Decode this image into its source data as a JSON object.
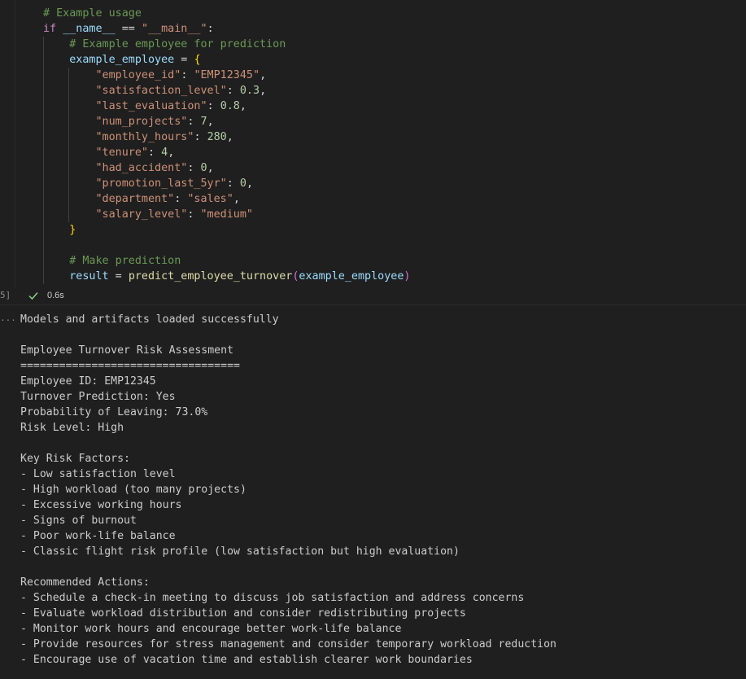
{
  "cell": {
    "execution_count": "5]",
    "exec_time": "0.6s",
    "code_lines": [
      [
        {
          "t": "# Example usage",
          "c": "tok-comment"
        }
      ],
      [
        {
          "t": "if ",
          "c": "tok-kw"
        },
        {
          "t": "__name__",
          "c": "tok-var"
        },
        {
          "t": " == ",
          "c": "tok-op"
        },
        {
          "t": "\"__main__\"",
          "c": "tok-str"
        },
        {
          "t": ":",
          "c": "tok-op"
        }
      ],
      [
        {
          "t": "    # Example employee for prediction",
          "c": "tok-comment"
        }
      ],
      [
        {
          "t": "    ",
          "c": "tok-op"
        },
        {
          "t": "example_employee",
          "c": "tok-var"
        },
        {
          "t": " = ",
          "c": "tok-op"
        },
        {
          "t": "{",
          "c": "tok-brace"
        }
      ],
      [
        {
          "t": "        ",
          "c": "tok-op"
        },
        {
          "t": "\"employee_id\"",
          "c": "tok-str"
        },
        {
          "t": ": ",
          "c": "tok-op"
        },
        {
          "t": "\"EMP12345\"",
          "c": "tok-str"
        },
        {
          "t": ",",
          "c": "tok-op"
        }
      ],
      [
        {
          "t": "        ",
          "c": "tok-op"
        },
        {
          "t": "\"satisfaction_level\"",
          "c": "tok-str"
        },
        {
          "t": ": ",
          "c": "tok-op"
        },
        {
          "t": "0.3",
          "c": "tok-num"
        },
        {
          "t": ",",
          "c": "tok-op"
        }
      ],
      [
        {
          "t": "        ",
          "c": "tok-op"
        },
        {
          "t": "\"last_evaluation\"",
          "c": "tok-str"
        },
        {
          "t": ": ",
          "c": "tok-op"
        },
        {
          "t": "0.8",
          "c": "tok-num"
        },
        {
          "t": ",",
          "c": "tok-op"
        }
      ],
      [
        {
          "t": "        ",
          "c": "tok-op"
        },
        {
          "t": "\"num_projects\"",
          "c": "tok-str"
        },
        {
          "t": ": ",
          "c": "tok-op"
        },
        {
          "t": "7",
          "c": "tok-num"
        },
        {
          "t": ",",
          "c": "tok-op"
        }
      ],
      [
        {
          "t": "        ",
          "c": "tok-op"
        },
        {
          "t": "\"monthly_hours\"",
          "c": "tok-str"
        },
        {
          "t": ": ",
          "c": "tok-op"
        },
        {
          "t": "280",
          "c": "tok-num"
        },
        {
          "t": ",",
          "c": "tok-op"
        }
      ],
      [
        {
          "t": "        ",
          "c": "tok-op"
        },
        {
          "t": "\"tenure\"",
          "c": "tok-str"
        },
        {
          "t": ": ",
          "c": "tok-op"
        },
        {
          "t": "4",
          "c": "tok-num"
        },
        {
          "t": ",",
          "c": "tok-op"
        }
      ],
      [
        {
          "t": "        ",
          "c": "tok-op"
        },
        {
          "t": "\"had_accident\"",
          "c": "tok-str"
        },
        {
          "t": ": ",
          "c": "tok-op"
        },
        {
          "t": "0",
          "c": "tok-num"
        },
        {
          "t": ",",
          "c": "tok-op"
        }
      ],
      [
        {
          "t": "        ",
          "c": "tok-op"
        },
        {
          "t": "\"promotion_last_5yr\"",
          "c": "tok-str"
        },
        {
          "t": ": ",
          "c": "tok-op"
        },
        {
          "t": "0",
          "c": "tok-num"
        },
        {
          "t": ",",
          "c": "tok-op"
        }
      ],
      [
        {
          "t": "        ",
          "c": "tok-op"
        },
        {
          "t": "\"department\"",
          "c": "tok-str"
        },
        {
          "t": ": ",
          "c": "tok-op"
        },
        {
          "t": "\"sales\"",
          "c": "tok-str"
        },
        {
          "t": ",",
          "c": "tok-op"
        }
      ],
      [
        {
          "t": "        ",
          "c": "tok-op"
        },
        {
          "t": "\"salary_level\"",
          "c": "tok-str"
        },
        {
          "t": ": ",
          "c": "tok-op"
        },
        {
          "t": "\"medium\"",
          "c": "tok-str"
        }
      ],
      [
        {
          "t": "    ",
          "c": "tok-op"
        },
        {
          "t": "}",
          "c": "tok-brace"
        }
      ],
      [],
      [
        {
          "t": "    # Make prediction",
          "c": "tok-comment"
        }
      ],
      [
        {
          "t": "    ",
          "c": "tok-op"
        },
        {
          "t": "result",
          "c": "tok-var"
        },
        {
          "t": " = ",
          "c": "tok-op"
        },
        {
          "t": "predict_employee_turnover",
          "c": "tok-fn"
        },
        {
          "t": "(",
          "c": "tok-paren"
        },
        {
          "t": "example_employee",
          "c": "tok-var"
        },
        {
          "t": ")",
          "c": "tok-paren"
        }
      ]
    ]
  },
  "output": {
    "marker": "...",
    "lines": [
      "Models and artifacts loaded successfully",
      "",
      "Employee Turnover Risk Assessment",
      "==================================",
      "Employee ID: EMP12345",
      "Turnover Prediction: Yes",
      "Probability of Leaving: 73.0%",
      "Risk Level: High",
      "",
      "Key Risk Factors:",
      "- Low satisfaction level",
      "- High workload (too many projects)",
      "- Excessive working hours",
      "- Signs of burnout",
      "- Poor work-life balance",
      "- Classic flight risk profile (low satisfaction but high evaluation)",
      "",
      "Recommended Actions:",
      "- Schedule a check-in meeting to discuss job satisfaction and address concerns",
      "- Evaluate workload distribution and consider redistributing projects",
      "- Monitor work hours and encourage better work-life balance",
      "- Provide resources for stress management and consider temporary workload reduction",
      "- Encourage use of vacation time and establish clearer work boundaries"
    ]
  },
  "icons": {
    "check": "check-icon"
  },
  "colors": {
    "background": "#1f1f1f",
    "success": "#89d185"
  }
}
